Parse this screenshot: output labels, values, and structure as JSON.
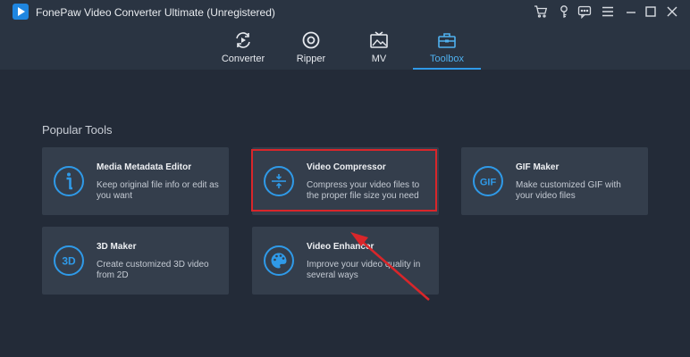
{
  "app": {
    "title": "FonePaw Video Converter Ultimate (Unregistered)"
  },
  "window_controls": [
    "cart-icon",
    "key-icon",
    "feedback-icon",
    "menu-icon",
    "minimize-icon",
    "maximize-icon",
    "close-icon"
  ],
  "tabs": [
    {
      "label": "Converter",
      "icon": "converter-icon",
      "active": false
    },
    {
      "label": "Ripper",
      "icon": "ripper-icon",
      "active": false
    },
    {
      "label": "MV",
      "icon": "mv-icon",
      "active": false
    },
    {
      "label": "Toolbox",
      "icon": "toolbox-icon",
      "active": true
    }
  ],
  "section": {
    "title": "Popular Tools"
  },
  "tools": [
    {
      "title": "Media Metadata Editor",
      "desc": "Keep original file info or edit as you want",
      "icon": "info-icon"
    },
    {
      "title": "Video Compressor",
      "desc": "Compress your video files to the proper file size you need",
      "icon": "compress-icon"
    },
    {
      "title": "GIF Maker",
      "desc": "Make customized GIF with your video files",
      "icon": "gif-icon",
      "icon_text": "GIF"
    },
    {
      "title": "3D Maker",
      "desc": "Create customized 3D video from 2D",
      "icon": "3d-icon",
      "icon_text": "3D"
    },
    {
      "title": "Video Enhancer",
      "desc": "Improve your video quality in several ways",
      "icon": "palette-icon"
    }
  ],
  "colors": {
    "accent": "#2f9ae8",
    "highlight": "#d9262a",
    "background": "#232b38",
    "card": "#343e4c"
  }
}
